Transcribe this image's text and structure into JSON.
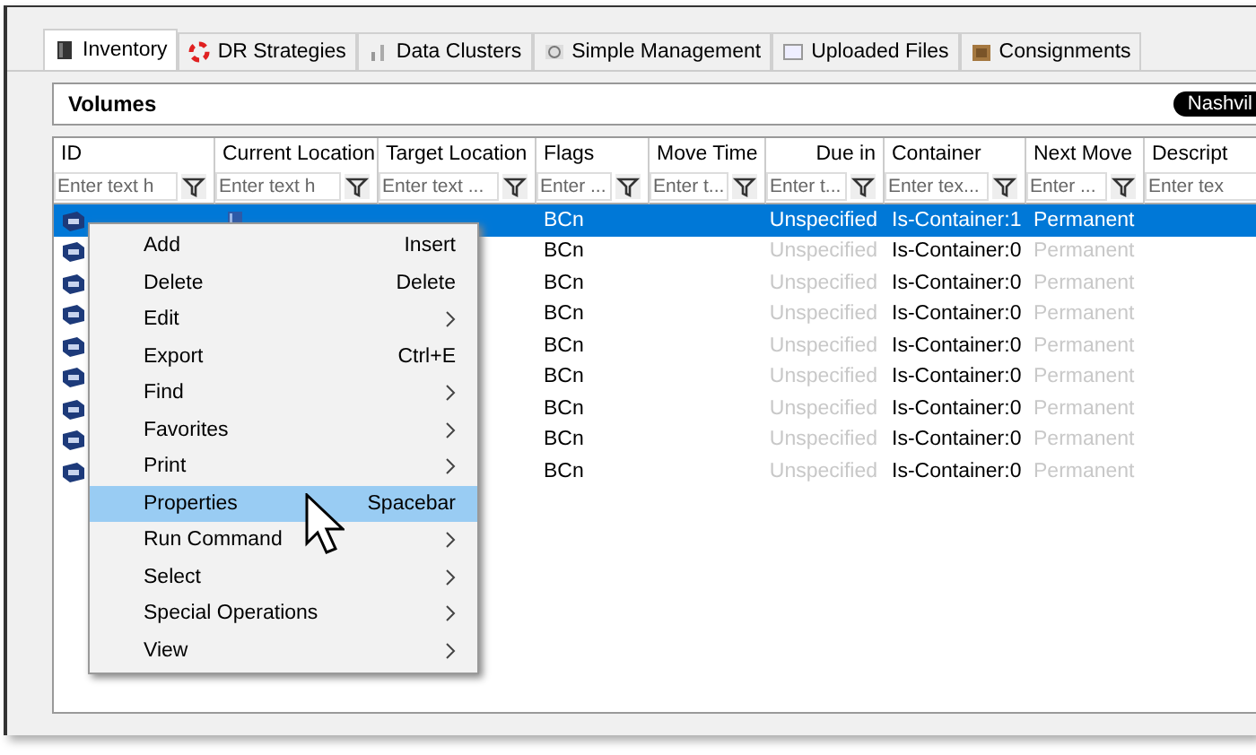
{
  "tabs": [
    {
      "label": "Inventory",
      "selected": true
    },
    {
      "label": "DR Strategies",
      "selected": false
    },
    {
      "label": "Data Clusters",
      "selected": false
    },
    {
      "label": "Simple Management",
      "selected": false
    },
    {
      "label": "Uploaded Files",
      "selected": false
    },
    {
      "label": "Consignments",
      "selected": false
    }
  ],
  "panel": {
    "title": "Volumes",
    "badge": "Nashvil"
  },
  "table": {
    "columns": [
      {
        "label": "ID",
        "placeholder": "Enter text h"
      },
      {
        "label": "Current Location",
        "placeholder": "Enter text h"
      },
      {
        "label": "Target Location",
        "placeholder": "Enter text ..."
      },
      {
        "label": "Flags",
        "placeholder": "Enter ..."
      },
      {
        "label": "Move Time",
        "placeholder": "Enter t..."
      },
      {
        "label": "Due in",
        "placeholder": "Enter t..."
      },
      {
        "label": "Container",
        "placeholder": "Enter tex..."
      },
      {
        "label": "Next Move",
        "placeholder": "Enter ..."
      },
      {
        "label": "Descript",
        "placeholder": "Enter tex"
      }
    ],
    "rows": [
      {
        "selected": true,
        "flags": "BCn",
        "due_in": "Unspecified",
        "container": "Is-Container:1",
        "next_move": "Permanent"
      },
      {
        "selected": false,
        "flags": "BCn",
        "due_in": "Unspecified",
        "container": "Is-Container:0",
        "next_move": "Permanent"
      },
      {
        "selected": false,
        "flags": "BCn",
        "due_in": "Unspecified",
        "container": "Is-Container:0",
        "next_move": "Permanent"
      },
      {
        "selected": false,
        "flags": "BCn",
        "due_in": "Unspecified",
        "container": "Is-Container:0",
        "next_move": "Permanent"
      },
      {
        "selected": false,
        "flags": "BCn",
        "due_in": "Unspecified",
        "container": "Is-Container:0",
        "next_move": "Permanent"
      },
      {
        "selected": false,
        "flags": "BCn",
        "due_in": "Unspecified",
        "container": "Is-Container:0",
        "next_move": "Permanent"
      },
      {
        "selected": false,
        "flags": "BCn",
        "due_in": "Unspecified",
        "container": "Is-Container:0",
        "next_move": "Permanent"
      },
      {
        "selected": false,
        "flags": "BCn",
        "due_in": "Unspecified",
        "container": "Is-Container:0",
        "next_move": "Permanent"
      },
      {
        "selected": false,
        "flags": "BCn",
        "due_in": "Unspecified",
        "container": "Is-Container:0",
        "next_move": "Permanent"
      }
    ]
  },
  "context_menu": {
    "items": [
      {
        "label": "Add",
        "shortcut": "Insert",
        "submenu": false,
        "selected": false
      },
      {
        "label": "Delete",
        "shortcut": "Delete",
        "submenu": false,
        "selected": false
      },
      {
        "label": "Edit",
        "submenu": true,
        "selected": false
      },
      {
        "label": "Export",
        "shortcut": "Ctrl+E",
        "submenu": false,
        "selected": false
      },
      {
        "label": "Find",
        "submenu": true,
        "selected": false
      },
      {
        "label": "Favorites",
        "submenu": true,
        "selected": false
      },
      {
        "label": "Print",
        "submenu": true,
        "selected": false
      },
      {
        "label": "Properties",
        "shortcut": "Spacebar",
        "submenu": false,
        "selected": true
      },
      {
        "label": "Run Command",
        "submenu": true,
        "selected": false
      },
      {
        "label": "Select",
        "submenu": true,
        "selected": false
      },
      {
        "label": "Special Operations",
        "submenu": true,
        "selected": false
      },
      {
        "label": "View",
        "submenu": true,
        "selected": false
      }
    ]
  }
}
